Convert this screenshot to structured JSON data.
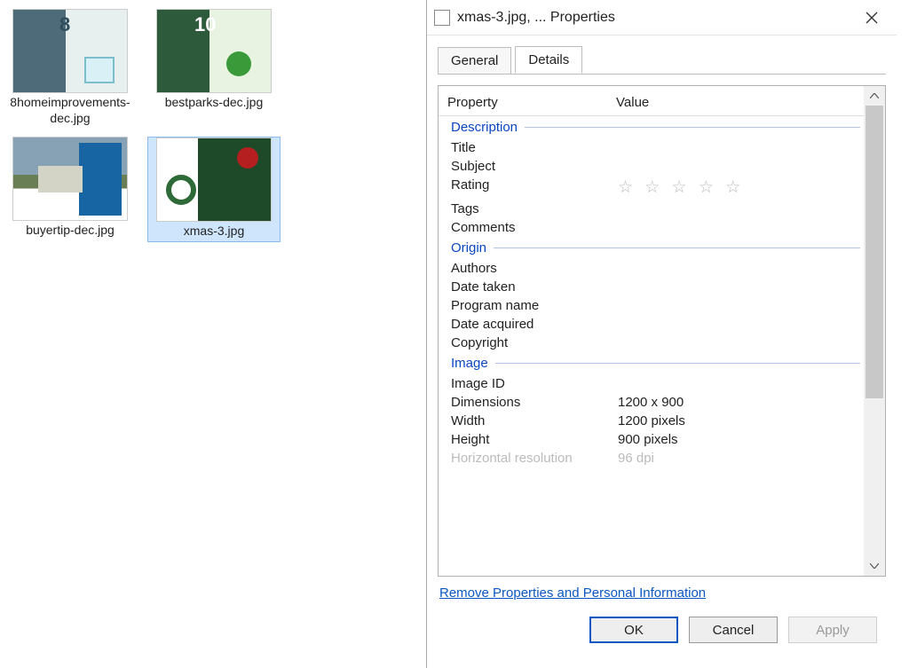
{
  "files": {
    "items": [
      {
        "name": "8homeimprovements-dec.jpg"
      },
      {
        "name": "bestparks-dec.jpg"
      },
      {
        "name": "buyertip-dec.jpg"
      },
      {
        "name": "xmas-3.jpg"
      }
    ],
    "selected_index": 3
  },
  "dialog": {
    "title": "xmas-3.jpg, ... Properties",
    "tabs": {
      "general": "General",
      "details": "Details"
    },
    "header": {
      "property": "Property",
      "value": "Value"
    },
    "sections": {
      "description": {
        "label": "Description",
        "fields": {
          "title": "Title",
          "subject": "Subject",
          "rating": "Rating",
          "tags": "Tags",
          "comments": "Comments"
        }
      },
      "origin": {
        "label": "Origin",
        "fields": {
          "authors": "Authors",
          "date_taken": "Date taken",
          "program_name": "Program name",
          "date_acquired": "Date acquired",
          "copyright": "Copyright"
        }
      },
      "image": {
        "label": "Image",
        "fields": {
          "image_id": "Image ID",
          "dimensions": "Dimensions",
          "width": "Width",
          "height": "Height",
          "h_res": "Horizontal resolution"
        },
        "values": {
          "dimensions": "1200 x 900",
          "width": "1200 pixels",
          "height": "900 pixels",
          "h_res": "96 dpi"
        }
      }
    },
    "remove_link": "Remove Properties and Personal Information",
    "buttons": {
      "ok": "OK",
      "cancel": "Cancel",
      "apply": "Apply"
    },
    "stars": "☆ ☆ ☆ ☆ ☆"
  }
}
